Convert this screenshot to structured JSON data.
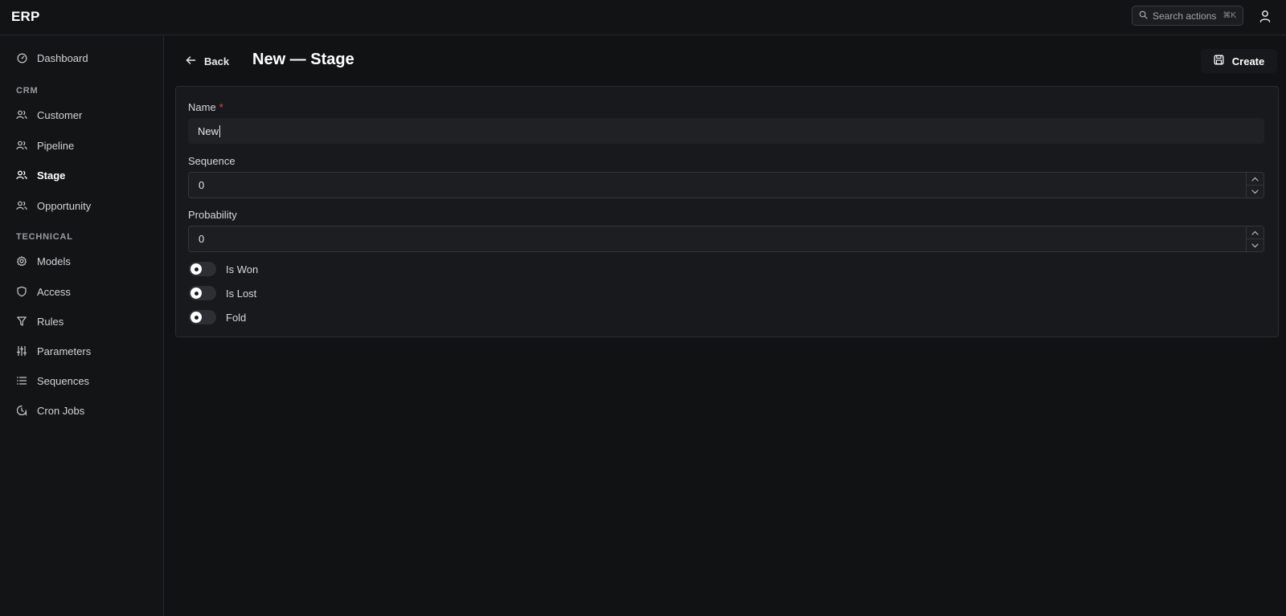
{
  "app": {
    "brand": "ERP"
  },
  "search": {
    "label": "Search actions",
    "shortcut": "⌘K"
  },
  "sidebar": {
    "dashboard": "Dashboard",
    "crm_section": "CRM",
    "crm_items": [
      "Customer",
      "Pipeline",
      "Stage",
      "Opportunity"
    ],
    "technical_section": "TECHNICAL",
    "technical_items": [
      "Models",
      "Access",
      "Rules",
      "Parameters",
      "Sequences",
      "Cron Jobs"
    ],
    "active": "Stage"
  },
  "header": {
    "back_label": "Back",
    "title": "New — Stage",
    "create_label": "Create"
  },
  "form": {
    "name_label": "Name",
    "name_required_mark": "*",
    "name_value": "New",
    "sequence_label": "Sequence",
    "sequence_value": "0",
    "probability_label": "Probability",
    "probability_value": "0",
    "toggles": [
      {
        "label": "Is Won",
        "on": false
      },
      {
        "label": "Is Lost",
        "on": false
      },
      {
        "label": "Fold",
        "on": false
      }
    ]
  },
  "colors": {
    "background": "#111214",
    "card": "#18191c",
    "required": "#e24a4a"
  }
}
